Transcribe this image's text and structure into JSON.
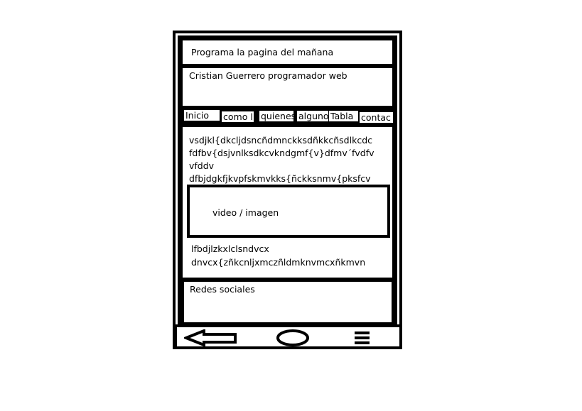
{
  "header": {
    "title": "Programa la pagina del mañana"
  },
  "subheader": {
    "text": "Cristian Guerrero programador web"
  },
  "nav": {
    "tabs": [
      {
        "label": "Inicio"
      },
      {
        "label": "como l"
      },
      {
        "label": "quienes"
      },
      {
        "label": "alguno"
      },
      {
        "label": "Tabla"
      },
      {
        "label": "contac"
      }
    ]
  },
  "content": {
    "lines_top": [
      "vsdjkl{dkcljdsncñdmnckksdñkkcñsdlkcdc",
      "fdfbv{dsjvnlksdkcvkndgmf{v}dfmv´fvdfv",
      "vfddv",
      "dfbjdgkfjkvpfskmvkks{ñckksnmv{pksfcv"
    ],
    "media_label": "video / imagen",
    "lines_bottom": [
      "lfbdjlzkxlclsndvcx",
      "dnvcx{zñkcnljxmczñldmknvmcxñkmvn"
    ]
  },
  "footer": {
    "text": "Redes sociales"
  },
  "navbar": {
    "icons": [
      "back-arrow-icon",
      "home-circle-icon",
      "menu-icon"
    ]
  }
}
